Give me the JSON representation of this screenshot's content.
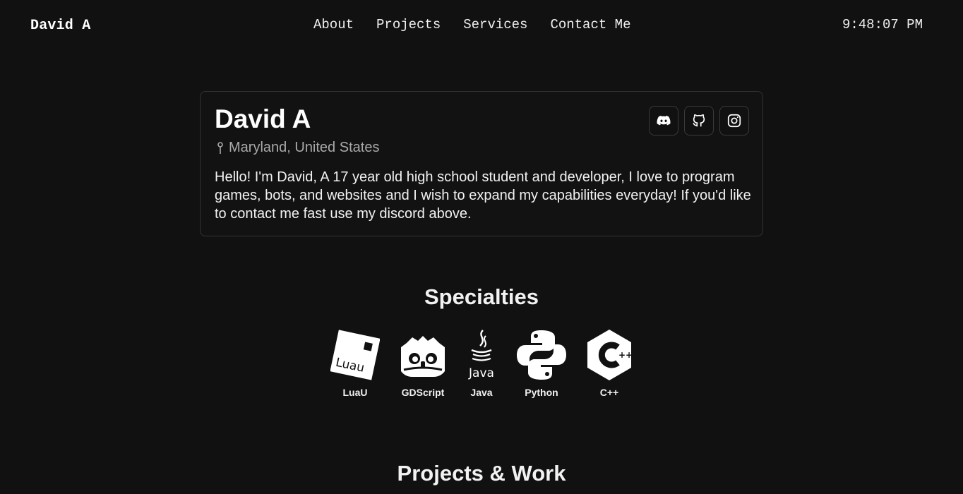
{
  "nav": {
    "brand": "David A",
    "links": [
      "About",
      "Projects",
      "Services",
      "Contact Me"
    ],
    "clock": "9:48:07 PM"
  },
  "profile": {
    "name": "David A",
    "location": "Maryland, United States",
    "bio": "Hello! I'm David, A 17 year old high school student and developer, I love to program games, bots, and websites and I wish to expand my capabilities everyday! If you'd like to contact me fast use my discord above.",
    "socials": [
      {
        "icon": "discord-icon"
      },
      {
        "icon": "github-icon"
      },
      {
        "icon": "instagram-icon"
      }
    ]
  },
  "specialties": {
    "title": "Specialties",
    "items": [
      {
        "label": "LuaU",
        "icon": "luau-logo-icon",
        "logo_text": "Luau"
      },
      {
        "label": "GDScript",
        "icon": "godot-logo-icon"
      },
      {
        "label": "Java",
        "icon": "java-logo-icon",
        "logo_text": "Java"
      },
      {
        "label": "Python",
        "icon": "python-logo-icon"
      },
      {
        "label": "C++",
        "icon": "cpp-logo-icon"
      }
    ]
  },
  "projects": {
    "title": "Projects & Work"
  },
  "colors": {
    "background": "#111111",
    "text": "#f2f2f2",
    "muted": "#a9a9a9",
    "border": "#333333"
  }
}
